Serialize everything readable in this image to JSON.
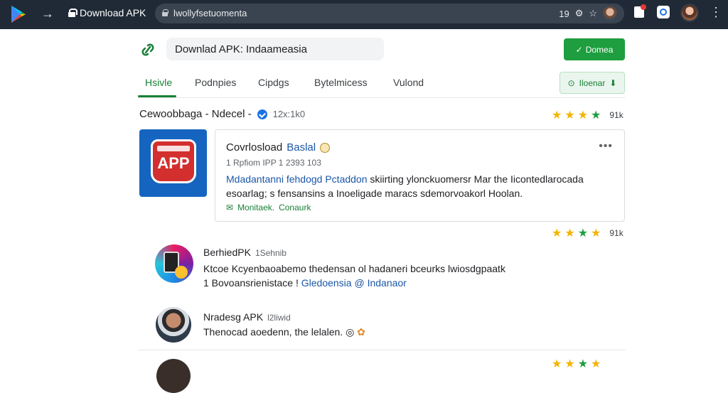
{
  "browser": {
    "tab_title": "Download APK",
    "url": "lwollyfsetuomenta",
    "zoom": "19",
    "back_icon": "arrow-right-icon",
    "colors": {
      "bar": "#1f2a36",
      "omnibox": "#3a4450"
    }
  },
  "header": {
    "search_text": "Downlad APK: Indaameasia",
    "install_label": "Domea",
    "install_icon": "check-icon"
  },
  "tabs": [
    {
      "label": "Hsivle",
      "active": true
    },
    {
      "label": "Podnpies",
      "active": false
    },
    {
      "label": "Cipdgs",
      "active": false
    },
    {
      "label": "Bytelmicess",
      "active": false
    },
    {
      "label": "Vulond",
      "active": false
    }
  ],
  "filter_button": {
    "label": "Iloenar"
  },
  "section": {
    "title": "Cewoobbaga - Ndecel -",
    "count": "12x:1k0",
    "rating": "91k"
  },
  "app_tile": {
    "badge_text": "APP"
  },
  "card": {
    "title_prefix": "Covrlosload",
    "title_highlight": "Baslal",
    "meta": "1 Rpfiom IPP 1 2393 103",
    "desc_blue": "Mdadantanni fehdogd Pctaddon",
    "desc_rest": " skiirting ylonckuomersr Mar the Iicontedlarocada esoarlag; s fensansins a Inoeligade maracs sdemorvoakorl Hoolan.",
    "link_label": "Monitaek.",
    "link_extra": "Conaurk",
    "rating": "91k"
  },
  "list": [
    {
      "title": "BerhiedPK",
      "sub": "1Sehnib",
      "line1": "Ktcoe Kcyenbaoabemo thedensan ol hadaneri bceurks lwiosdgpaatk",
      "line2_prefix": "1 Bovoansrienistace !",
      "line2_blue1": "Gledoensia",
      "line2_blue2": "Indanaor"
    },
    {
      "title": "Nradesg APK",
      "sub": "l2liwid",
      "line1": "Thenocad aoedenn, the lelalen."
    }
  ],
  "colors": {
    "accent_green": "#188038",
    "button_green": "#1e9e3e",
    "link_blue": "#1a56a8",
    "star_yellow": "#f4b400"
  }
}
